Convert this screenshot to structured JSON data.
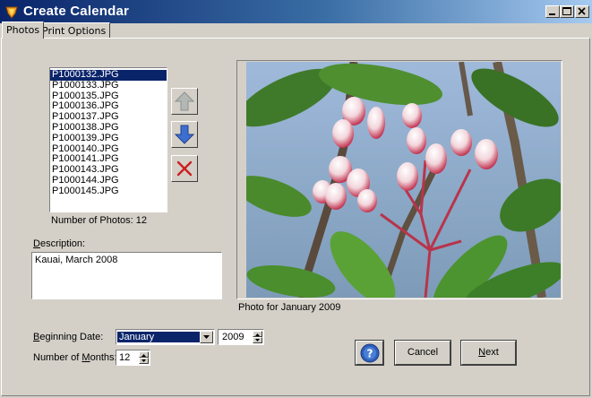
{
  "window": {
    "title": "Create Calendar"
  },
  "tabs": [
    {
      "label": "Photos",
      "active": true
    },
    {
      "label": "Print Options",
      "active": false
    }
  ],
  "photos": {
    "items": [
      "P1000132.JPG",
      "P1000133.JPG",
      "P1000135.JPG",
      "P1000136.JPG",
      "P1000137.JPG",
      "P1000138.JPG",
      "P1000139.JPG",
      "P1000140.JPG",
      "P1000141.JPG",
      "P1000143.JPG",
      "P1000144.JPG",
      "P1000145.JPG"
    ],
    "selected_index": 0,
    "count_label": "Number of Photos: 12",
    "tools": [
      "arrow-up-icon",
      "arrow-down-icon",
      "delete-icon"
    ]
  },
  "description": {
    "label_underlined": "D",
    "label_rest": "escription:",
    "value": "Kauai, March 2008"
  },
  "preview": {
    "caption": "Photo for January 2009"
  },
  "beginning_date": {
    "label_underlined": "B",
    "label_rest": "eginning Date:",
    "month": "January",
    "year": "2009"
  },
  "months": {
    "label_pre": "Number of ",
    "label_underlined": "M",
    "label_post": "onths:",
    "value": "12"
  },
  "buttons": {
    "help_icon": "question-icon",
    "cancel": "Cancel",
    "next_underlined": "N",
    "next_rest": "ext"
  },
  "colors": {
    "title_start": "#0a246a",
    "title_end": "#a6caf0",
    "selection": "#0a246a",
    "delete_red": "#cc1f1f",
    "arrow_blue": "#3d6fd1"
  }
}
